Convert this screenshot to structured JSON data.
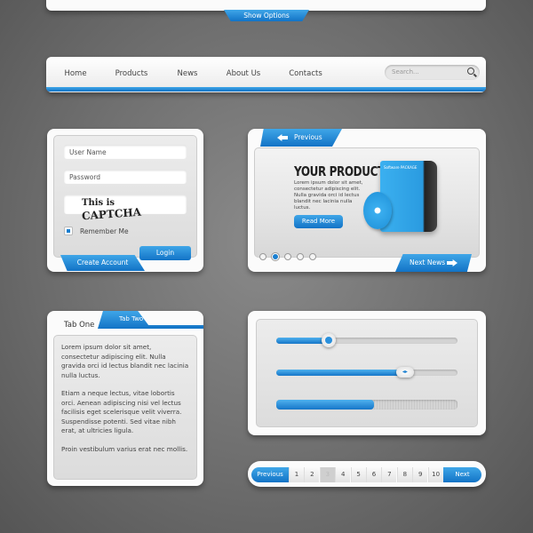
{
  "top": {
    "show_options": "Show Options"
  },
  "nav": {
    "items": [
      "Home",
      "Products",
      "News",
      "About Us",
      "Contacts"
    ],
    "search_placeholder": "Search...",
    "search_icon": "magnifier-icon"
  },
  "login": {
    "username_placeholder": "User Name",
    "password_placeholder": "Password",
    "captcha_prefix": "This is",
    "captcha_word": "CAPTCHA",
    "remember_me": "Remember Me",
    "remember_checked": true,
    "login_button": "Login",
    "create_account": "Create Account"
  },
  "slider": {
    "previous": "Previous",
    "next": "Next News",
    "title": "YOUR PRODUCT",
    "body": "Lorem ipsum dolor sit amet, consectetur adipiscing elit. Nulla gravida orci id lectus blandit nec lacinia nulla luctus.",
    "read_more": "Read More",
    "box_label": "Software PACKAGE",
    "active_dot": 2,
    "dot_count": 5
  },
  "tabs": {
    "tab_one": "Tab One",
    "tab_two": "Tab Two",
    "paragraphs": [
      "Lorem ipsum dolor sit amet, consectetur adipiscing elit. Nulla gravida orci id lectus blandit nec lacinia nulla luctus.",
      "Etiam a neque lectus, vitae lobortis orci. Aenean adipiscing nisi vel lectus facilisis eget scelerisque velit viverra. Suspendisse potenti. Sed vitae nibh erat, at ultricies ligula.",
      "Proin vestibulum varius erat nec mollis."
    ]
  },
  "controls": {
    "slider1_percent": 29,
    "slider2_percent": 71,
    "progress_percent": 54
  },
  "pagination": {
    "previous": "Previous",
    "next": "Next",
    "pages": [
      "1",
      "2",
      "3",
      "4",
      "5",
      "6",
      "7",
      "8",
      "9",
      "10"
    ],
    "current": "3"
  },
  "colors": {
    "accent": "#1a7fd0",
    "background": "#6e6e6e"
  }
}
